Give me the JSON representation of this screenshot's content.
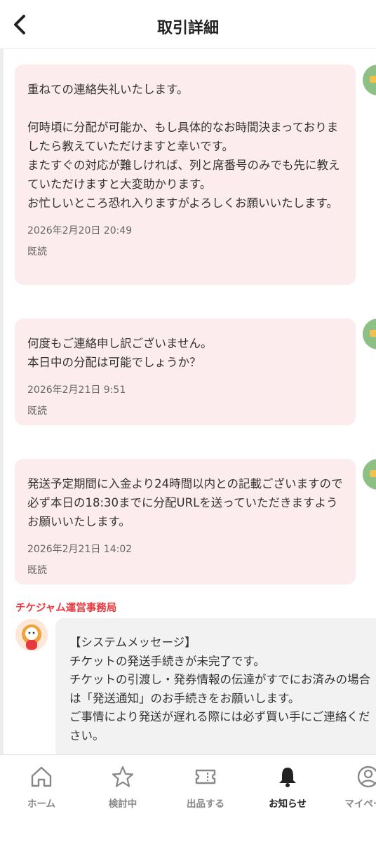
{
  "header": {
    "title": "取引詳細"
  },
  "messages": [
    {
      "text": "重ねての連絡失礼いたします。\n\n何時頃に分配が可能か、もし具体的なお時間決まっておりましたら教えていただけますと幸いです。\nまたすぐの対応が難しければ、列と席番号のみでも先に教えていただけますと大変助かります。\nお忙しいところ恐れ入りますがよろしくお願いいたします。",
      "time": "2026年2月20日 20:49",
      "status": "既読"
    },
    {
      "text": "何度もご連絡申し訳ございません。\n本日中の分配は可能でしょうか？",
      "time": "2026年2月21日 9:51",
      "status": "既読"
    },
    {
      "text": "発送予定期間に入金より24時間以内との記載ございますので必ず本日の18:30までに分配URLを送っていただきますようお願いいたします。",
      "time": "2026年2月21日 14:02",
      "status": "既読"
    }
  ],
  "system": {
    "sender": "チケジャム運営事務局",
    "text": "【システムメッセージ】\nチケットの発送手続きが未完了です。\nチケットの引渡し・発券情報の伝達がすでにお済みの場合は「発送通知」のお手続きをお願いします。\nご事情により発送が遅れる際には必ず買い手にご連絡ください。"
  },
  "tabs": [
    {
      "label": "ホーム",
      "icon": "home-icon"
    },
    {
      "label": "検討中",
      "icon": "star-icon"
    },
    {
      "label": "出品する",
      "icon": "ticket-icon"
    },
    {
      "label": "お知らせ",
      "icon": "bell-icon",
      "active": true
    },
    {
      "label": "マイページ",
      "icon": "user-icon"
    }
  ],
  "colors": {
    "bubble_bg": "#fdeced",
    "system_bubble_bg": "#f2f2f2",
    "sender_color": "#e8383d",
    "avatar_green": "#8cc084"
  }
}
